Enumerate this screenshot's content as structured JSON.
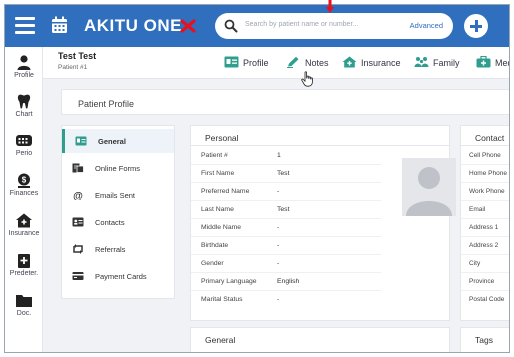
{
  "app": {
    "brand": "AKITU ONE",
    "search_placeholder": "Search by patient name or number...",
    "advanced_label": "Advanced"
  },
  "sidebar": {
    "items": [
      {
        "label": "Profile",
        "icon": "person-icon"
      },
      {
        "label": "Chart",
        "icon": "tooth-icon"
      },
      {
        "label": "Perio",
        "icon": "perio-icon"
      },
      {
        "label": "Finances",
        "icon": "finances-icon"
      },
      {
        "label": "Insurance",
        "icon": "insurance-icon"
      },
      {
        "label": "Predeter.",
        "icon": "predetermination-icon"
      },
      {
        "label": "Doc.",
        "icon": "folder-icon"
      }
    ]
  },
  "patient": {
    "name": "Test Test",
    "number_label": "Patient #1"
  },
  "tabs": [
    {
      "label": "Profile",
      "icon": "id-card-icon"
    },
    {
      "label": "Notes",
      "icon": "pencil-icon"
    },
    {
      "label": "Insurance",
      "icon": "house-icon"
    },
    {
      "label": "Family",
      "icon": "family-icon"
    },
    {
      "label": "Med",
      "icon": "medical-bag-icon"
    }
  ],
  "page_title": "Patient Profile",
  "left_nav": [
    {
      "label": "General",
      "icon": "id-card-icon",
      "active": true
    },
    {
      "label": "Online Forms",
      "icon": "forms-icon",
      "active": false
    },
    {
      "label": "Emails Sent",
      "icon": "at-icon",
      "active": false
    },
    {
      "label": "Contacts",
      "icon": "contact-card-icon",
      "active": false
    },
    {
      "label": "Referrals",
      "icon": "referral-arrows-icon",
      "active": false
    },
    {
      "label": "Payment Cards",
      "icon": "payment-card-icon",
      "active": false
    }
  ],
  "personal": {
    "title": "Personal",
    "rows": [
      {
        "label": "Patient #",
        "value": "1"
      },
      {
        "label": "First Name",
        "value": "Test"
      },
      {
        "label": "Preferred Name",
        "value": "-"
      },
      {
        "label": "Last Name",
        "value": "Test"
      },
      {
        "label": "Middle Name",
        "value": "-"
      },
      {
        "label": "Birthdate",
        "value": "-"
      },
      {
        "label": "Gender",
        "value": "-"
      },
      {
        "label": "Primary Language",
        "value": "English"
      },
      {
        "label": "Marital Status",
        "value": "-"
      }
    ]
  },
  "contact": {
    "title": "Contact",
    "rows": [
      "Cell Phone",
      "Home Phone",
      "Work Phone",
      "Email",
      "Address 1",
      "Address 2",
      "City",
      "Province",
      "Postal Code"
    ]
  },
  "general_card": {
    "title": "General"
  },
  "tags_card": {
    "title": "Tags"
  },
  "colors": {
    "primary": "#2f6fbd",
    "accent_teal": "#2f9e8f",
    "annotation_red": "#e8101c",
    "background": "#f0f2f5"
  }
}
